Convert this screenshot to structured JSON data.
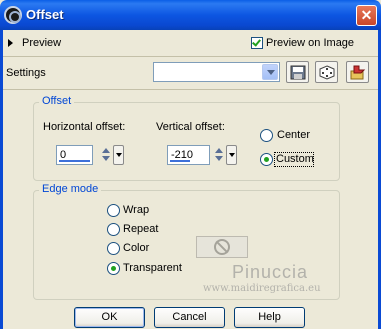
{
  "window": {
    "title": "Offset",
    "icons": {
      "app": "app-icon",
      "close": "close-icon"
    }
  },
  "preview": {
    "label": "Preview",
    "preview_on_image_label": "Preview on Image",
    "preview_on_image_checked": true
  },
  "settings": {
    "label": "Settings",
    "value": "",
    "buttons": [
      {
        "name": "save-preset-button",
        "icon": "floppy-disk-icon"
      },
      {
        "name": "random-preset-button",
        "icon": "dice-icon"
      },
      {
        "name": "preset-manager-button",
        "icon": "preset-folder-icon"
      }
    ]
  },
  "offset": {
    "title": "Offset",
    "horizontal_label": "Horizontal offset:",
    "horizontal_value": "0",
    "vertical_label": "Vertical offset:",
    "vertical_value": "-210",
    "options": [
      {
        "label": "Center",
        "selected": false
      },
      {
        "label": "Custom",
        "selected": true
      }
    ]
  },
  "edge_mode": {
    "title": "Edge mode",
    "options": [
      {
        "label": "Wrap",
        "selected": false
      },
      {
        "label": "Repeat",
        "selected": false
      },
      {
        "label": "Color",
        "selected": false
      },
      {
        "label": "Transparent",
        "selected": true
      }
    ],
    "color_swatch_icon": "no-color-icon"
  },
  "watermark": {
    "line1": "Pinuccia",
    "line2": "www.maidiregrafica.eu"
  },
  "buttons": {
    "ok": "OK",
    "cancel": "Cancel",
    "help": "Help"
  },
  "colors": {
    "title_bar": "#0a5ee6",
    "dialog_bg": "#ece9d8",
    "group_title": "#0046d5",
    "radio_check": "#21a121"
  }
}
